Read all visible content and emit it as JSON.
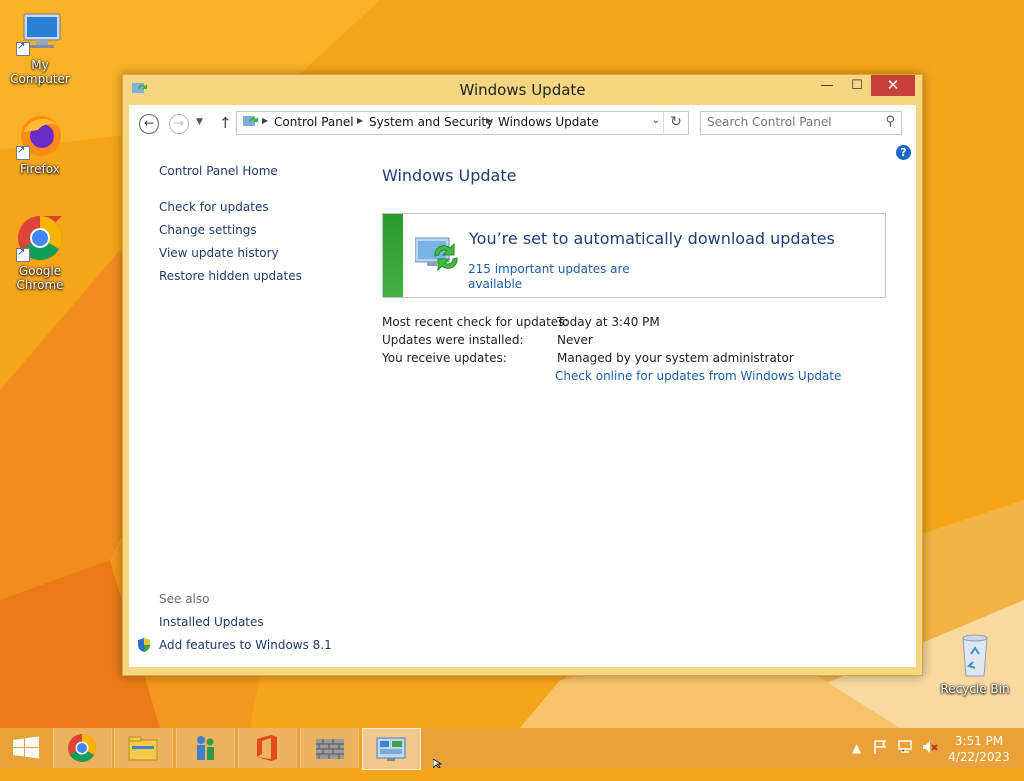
{
  "desktop": {
    "icons": [
      {
        "label": "My Computer"
      },
      {
        "label": "Firefox"
      },
      {
        "label": "Google Chrome"
      },
      {
        "label": "Recycle Bin"
      }
    ]
  },
  "window": {
    "title": "Windows Update",
    "controls": {
      "minimize": "—",
      "maximize": "☐",
      "close": "✕"
    },
    "address": {
      "segments": [
        "Control Panel",
        "System and Security",
        "Windows Update"
      ]
    },
    "search": {
      "placeholder": "Search Control Panel"
    },
    "help_label": "?",
    "left_nav": {
      "home": "Control Panel Home",
      "links": [
        "Check for updates",
        "Change settings",
        "View update history",
        "Restore hidden updates"
      ],
      "see_also_label": "See also",
      "see_also_links": [
        "Installed Updates",
        "Add features to Windows 8.1"
      ]
    },
    "main": {
      "heading": "Windows Update",
      "status_title": "You’re set to automatically download updates",
      "status_link": "215 important updates are available",
      "info": [
        {
          "label": "Most recent check for updates:",
          "value": "Today at 3:40 PM"
        },
        {
          "label": "Updates were installed:",
          "value": "Never"
        },
        {
          "label": "You receive updates:",
          "value": "Managed by your system administrator"
        }
      ],
      "online_link": "Check online for updates from Windows Update"
    }
  },
  "taskbar": {
    "apps": [
      "start-icon",
      "chrome-icon",
      "file-explorer-icon",
      "people-icon",
      "office-icon",
      "firewall-icon",
      "control-panel-icon"
    ],
    "clock": {
      "time": "3:51 PM",
      "date": "4/22/2023"
    }
  },
  "colors": {
    "wallpaper": "#f6a51a",
    "window_frame": "#f6d680",
    "link": "#1c5fa8",
    "heading": "#1e3e75",
    "status_green": "#2a9a2a",
    "close_red": "#c7413b"
  }
}
